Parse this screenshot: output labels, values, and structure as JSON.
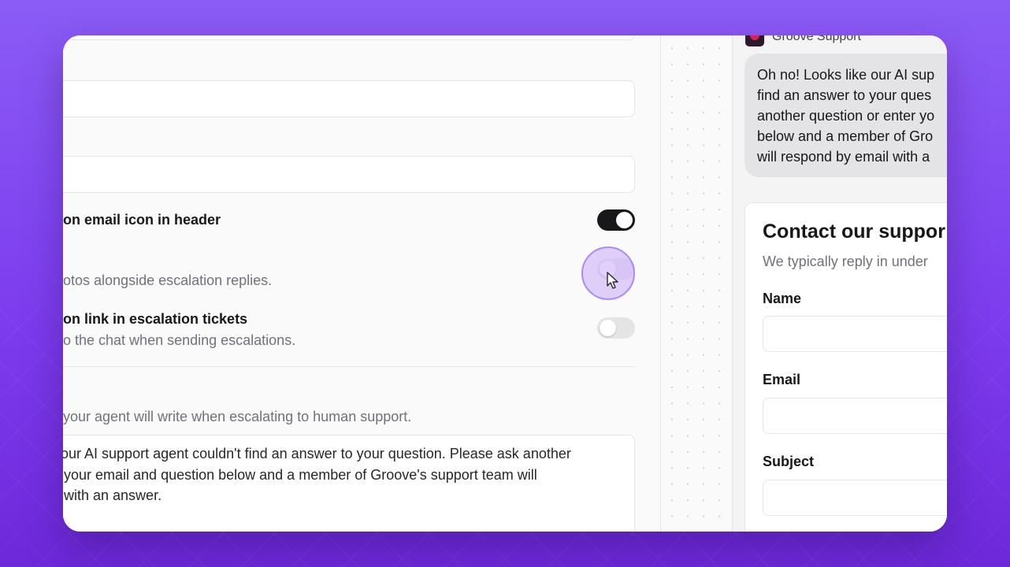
{
  "settings": {
    "toggle_email_icon": {
      "title": "on email icon in header",
      "enabled": true
    },
    "toggle_photos": {
      "description": "otos alongside escalation replies.",
      "enabled": false
    },
    "toggle_conversation_link": {
      "title": "on link in escalation tickets",
      "description": "o the chat when sending escalations.",
      "enabled": false
    },
    "escalation_message": {
      "description": "your agent will write when escalating to human support.",
      "lines": [
        "our AI support agent couldn't find an answer to your question. Please ask another",
        "your email and question below and a member of Groove's support team will",
        "with an answer."
      ]
    }
  },
  "chat": {
    "brand_name": "Groove Support",
    "bubble_lines": [
      "Oh no! Looks like our AI sup",
      "find an answer to your ques",
      "another question or enter yo",
      "below and a member of Gro",
      "will respond by email with a"
    ],
    "contact": {
      "title": "Contact our suppor",
      "subtitle": "We typically reply in under",
      "name_label": "Name",
      "email_label": "Email",
      "subject_label": "Subject"
    }
  }
}
